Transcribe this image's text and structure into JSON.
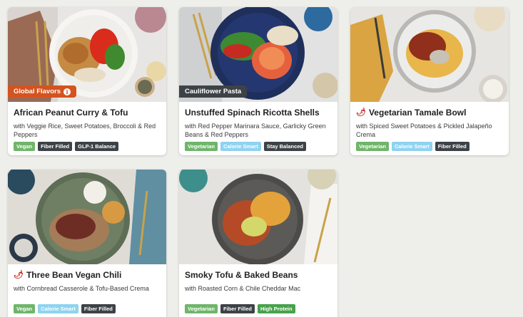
{
  "colors": {
    "vegan": "#6fb56a",
    "vegetarian": "#6fb56a",
    "calorie_smart": "#8fd3f0",
    "dark_tag": "#3d4247",
    "high_protein": "#48a24c",
    "global_badge": "#d4531f",
    "pasta_badge": "#3d4247"
  },
  "recipes": [
    {
      "badge": "Global Flavors",
      "title": "African Peanut Curry & Tofu",
      "subtitle": "with Veggie Rice, Sweet Potatoes, Broccoli & Red Peppers",
      "tags": [
        "Vegan",
        "Fiber Filled",
        "GLP-1 Balance"
      ]
    },
    {
      "badge": "Cauliflower Pasta",
      "title": "Unstuffed Spinach Ricotta Shells",
      "subtitle": "with Red Pepper Marinara Sauce, Garlicky Green Beans & Red Peppers",
      "tags": [
        "Vegetarian",
        "Calorie Smart",
        "Stay Balanced"
      ]
    },
    {
      "spicy_icon": "chili-pepper-icon",
      "title": "Vegetarian Tamale Bowl",
      "subtitle": "with Spiced Sweet Potatoes & Pickled Jalapeño Crema",
      "tags": [
        "Vegetarian",
        "Calorie Smart",
        "Fiber Filled"
      ]
    },
    {
      "spicy_icon": "chili-pepper-icon",
      "title": "Three Bean Vegan Chili",
      "subtitle": "with Cornbread Casserole & Tofu-Based Crema",
      "tags": [
        "Vegan",
        "Calorie Smart",
        "Fiber Filled"
      ]
    },
    {
      "title": "Smoky Tofu & Baked Beans",
      "subtitle": "with Roasted Corn & Chile Cheddar Mac",
      "tags": [
        "Vegetarian",
        "Fiber Filled",
        "High Protein"
      ]
    }
  ]
}
